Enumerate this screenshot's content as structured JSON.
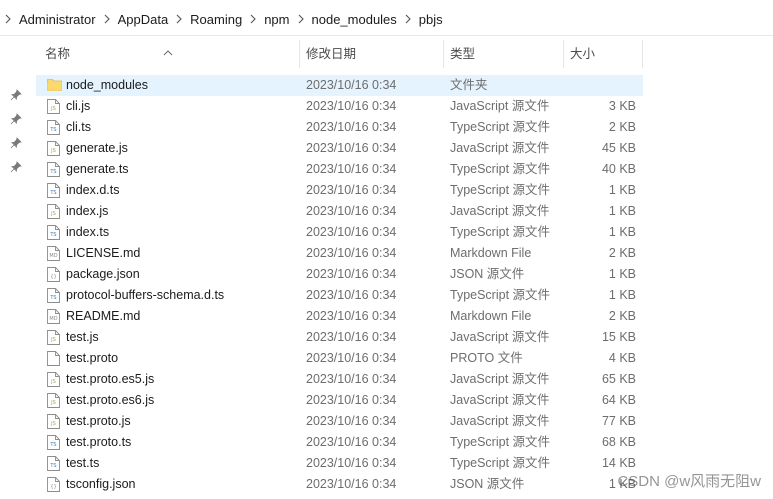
{
  "breadcrumb": [
    "Administrator",
    "AppData",
    "Roaming",
    "npm",
    "node_modules",
    "pbjs"
  ],
  "columns": {
    "name": "名称",
    "date": "修改日期",
    "type": "类型",
    "size": "大小"
  },
  "files": [
    {
      "name": "node_modules",
      "date": "2023/10/16 0:34",
      "type": "文件夹",
      "size": "",
      "icon": "folder-icon",
      "selected": true
    },
    {
      "name": "cli.js",
      "date": "2023/10/16 0:34",
      "type": "JavaScript 源文件",
      "size": "3 KB",
      "icon": "js-file-icon"
    },
    {
      "name": "cli.ts",
      "date": "2023/10/16 0:34",
      "type": "TypeScript 源文件",
      "size": "2 KB",
      "icon": "ts-file-icon"
    },
    {
      "name": "generate.js",
      "date": "2023/10/16 0:34",
      "type": "JavaScript 源文件",
      "size": "45 KB",
      "icon": "js-file-icon"
    },
    {
      "name": "generate.ts",
      "date": "2023/10/16 0:34",
      "type": "TypeScript 源文件",
      "size": "40 KB",
      "icon": "ts-file-icon"
    },
    {
      "name": "index.d.ts",
      "date": "2023/10/16 0:34",
      "type": "TypeScript 源文件",
      "size": "1 KB",
      "icon": "ts-file-icon"
    },
    {
      "name": "index.js",
      "date": "2023/10/16 0:34",
      "type": "JavaScript 源文件",
      "size": "1 KB",
      "icon": "js-file-icon"
    },
    {
      "name": "index.ts",
      "date": "2023/10/16 0:34",
      "type": "TypeScript 源文件",
      "size": "1 KB",
      "icon": "ts-file-icon"
    },
    {
      "name": "LICENSE.md",
      "date": "2023/10/16 0:34",
      "type": "Markdown File",
      "size": "2 KB",
      "icon": "md-file-icon"
    },
    {
      "name": "package.json",
      "date": "2023/10/16 0:34",
      "type": "JSON 源文件",
      "size": "1 KB",
      "icon": "json-file-icon"
    },
    {
      "name": "protocol-buffers-schema.d.ts",
      "date": "2023/10/16 0:34",
      "type": "TypeScript 源文件",
      "size": "1 KB",
      "icon": "ts-file-icon"
    },
    {
      "name": "README.md",
      "date": "2023/10/16 0:34",
      "type": "Markdown File",
      "size": "2 KB",
      "icon": "md-file-icon"
    },
    {
      "name": "test.js",
      "date": "2023/10/16 0:34",
      "type": "JavaScript 源文件",
      "size": "15 KB",
      "icon": "js-file-icon"
    },
    {
      "name": "test.proto",
      "date": "2023/10/16 0:34",
      "type": "PROTO 文件",
      "size": "4 KB",
      "icon": "blank-file-icon"
    },
    {
      "name": "test.proto.es5.js",
      "date": "2023/10/16 0:34",
      "type": "JavaScript 源文件",
      "size": "65 KB",
      "icon": "js-file-icon"
    },
    {
      "name": "test.proto.es6.js",
      "date": "2023/10/16 0:34",
      "type": "JavaScript 源文件",
      "size": "64 KB",
      "icon": "js-file-icon"
    },
    {
      "name": "test.proto.js",
      "date": "2023/10/16 0:34",
      "type": "JavaScript 源文件",
      "size": "77 KB",
      "icon": "js-file-icon"
    },
    {
      "name": "test.proto.ts",
      "date": "2023/10/16 0:34",
      "type": "TypeScript 源文件",
      "size": "68 KB",
      "icon": "ts-file-icon"
    },
    {
      "name": "test.ts",
      "date": "2023/10/16 0:34",
      "type": "TypeScript 源文件",
      "size": "14 KB",
      "icon": "ts-file-icon"
    },
    {
      "name": "tsconfig.json",
      "date": "2023/10/16 0:34",
      "type": "JSON 源文件",
      "size": "1 KB",
      "icon": "json-file-icon"
    }
  ],
  "watermark": "CSDN @w风雨无阻w",
  "colors": {
    "selected_row": "#e5f3ff",
    "folder": "#f8d775",
    "js_accent": "#c9b84a",
    "ts_accent": "#3f7fbf"
  }
}
